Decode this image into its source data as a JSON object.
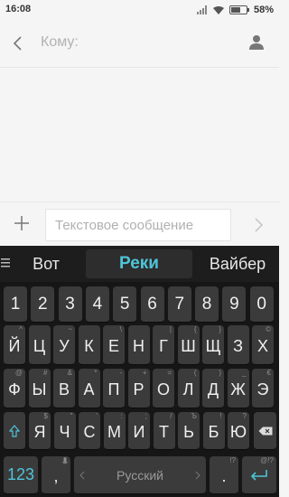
{
  "status": {
    "time": "16:08",
    "battery": "58%"
  },
  "header": {
    "to_placeholder": "Кому:"
  },
  "compose": {
    "placeholder": "Текстовое сообщение"
  },
  "keyboard": {
    "suggestions": [
      "Вот",
      "Реки",
      "Вайбер"
    ],
    "numbers": [
      "1",
      "2",
      "3",
      "4",
      "5",
      "6",
      "7",
      "8",
      "9",
      "0"
    ],
    "row1": [
      {
        "label": "Й",
        "hint": "^"
      },
      {
        "label": "Ц",
        "hint": ""
      },
      {
        "label": "У",
        "hint": "~"
      },
      {
        "label": "К",
        "hint": ""
      },
      {
        "label": "Е",
        "hint": "\\"
      },
      {
        "label": "Н",
        "hint": ""
      },
      {
        "label": "Г",
        "hint": "|"
      },
      {
        "label": "Ш",
        "hint": "{"
      },
      {
        "label": "Щ",
        "hint": "}"
      },
      {
        "label": "З",
        "hint": ""
      },
      {
        "label": "Х",
        "hint": "©"
      }
    ],
    "row2": [
      {
        "label": "Ф",
        "hint": "@"
      },
      {
        "label": "Ы",
        "hint": "#"
      },
      {
        "label": "В",
        "hint": "&"
      },
      {
        "label": "А",
        "hint": "*"
      },
      {
        "label": "П",
        "hint": "-"
      },
      {
        "label": "Р",
        "hint": "+"
      },
      {
        "label": "О",
        "hint": "="
      },
      {
        "label": "Л",
        "hint": "("
      },
      {
        "label": "Д",
        "hint": ")"
      },
      {
        "label": "Ж",
        "hint": "_"
      },
      {
        "label": "Э",
        "hint": "€"
      }
    ],
    "row3": [
      {
        "label": "Я",
        "hint": "$"
      },
      {
        "label": "Ч",
        "hint": "\""
      },
      {
        "label": "С",
        "hint": "'"
      },
      {
        "label": "М",
        "hint": ":"
      },
      {
        "label": "И",
        "hint": ";"
      },
      {
        "label": "Т",
        "hint": "/"
      },
      {
        "label": "Ь",
        "hint": "Ъ"
      },
      {
        "label": "Б",
        "hint": "!"
      },
      {
        "label": "Ю",
        "hint": "?"
      }
    ],
    "mode_label": "123",
    "comma": ",",
    "space_label": "Русский",
    "enter_hint": "@!?",
    "accent_color": "#4fc4d8"
  }
}
